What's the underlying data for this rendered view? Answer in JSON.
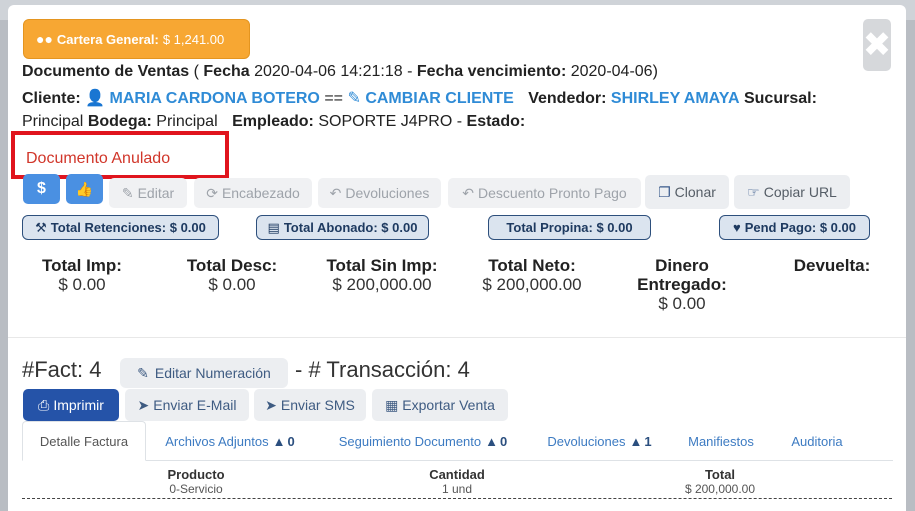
{
  "cartera": {
    "label": "Cartera General:",
    "value": "$ 1,241.00"
  },
  "header": {
    "doc_label": "Documento de Ventas",
    "fecha_label": "Fecha",
    "fecha_value": "2020-04-06 14:21:18",
    "venc_label": "Fecha vencimiento:",
    "venc_value": "2020-04-06",
    "cliente_label": "Cliente:",
    "cliente_name": "MARIA CARDONA BOTERO",
    "cliente_sep": "==",
    "cambiar_cliente": "CAMBIAR CLIENTE",
    "vendedor_label": "Vendedor:",
    "vendedor_name": "SHIRLEY AMAYA",
    "sucursal_label": "Sucursal:",
    "sucursal_value": "Principal",
    "bodega_label": "Bodega:",
    "bodega_value": "Principal",
    "empleado_label": "Empleado:",
    "empleado_value": "SOPORTE J4PRO",
    "estado_label": "Estado:",
    "estado_value": "Documento Anulado"
  },
  "toolbar": {
    "pay_icon": "$",
    "like_icon": "thumbs-up",
    "editar": "Editar",
    "encabezado": "Encabezado",
    "devoluciones": "Devoluciones",
    "descuento": "Descuento Pronto Pago",
    "clonar": "Clonar",
    "copiar_url": "Copiar URL"
  },
  "pills": {
    "retenciones": "Total Retenciones: $ 0.00",
    "abonado": "Total Abonado: $ 0.00",
    "propina": "Total Propina: $ 0.00",
    "pend_pago": "Pend Pago: $ 0.00"
  },
  "totals": [
    {
      "label": "Total Imp:",
      "value": "$ 0.00"
    },
    {
      "label": "Total Desc:",
      "value": "$ 0.00"
    },
    {
      "label": "Total Sin Imp:",
      "value": "$ 200,000.00"
    },
    {
      "label": "Total Neto:",
      "value": "$ 200,000.00"
    },
    {
      "label": "Dinero Entregado:",
      "value": "$ 0.00"
    },
    {
      "label": "Devuelta:",
      "value": ""
    }
  ],
  "factura": {
    "fact_label": "#Fact: 4",
    "editar_numeracion": "Editar Numeración",
    "trans_label": "- # Transacción: 4"
  },
  "actions": {
    "imprimir": "Imprimir",
    "enviar_email": "Enviar E-Mail",
    "enviar_sms": "Enviar SMS",
    "exportar": "Exportar Venta"
  },
  "tabs": [
    {
      "label": "Detalle Factura",
      "count": ""
    },
    {
      "label": "Archivos Adjuntos",
      "count": "0"
    },
    {
      "label": "Seguimiento Documento",
      "count": "0"
    },
    {
      "label": "Devoluciones",
      "count": "1"
    },
    {
      "label": "Manifiestos",
      "count": ""
    },
    {
      "label": "Auditoria",
      "count": ""
    }
  ],
  "table": {
    "headers": [
      "Producto",
      "Cantidad",
      "Total"
    ],
    "rows": [
      [
        "0-Servicio",
        "1 und",
        "$ 200,000.00"
      ]
    ]
  },
  "colors": {
    "accent": "#2f8bd6",
    "warning": "#f7a733",
    "danger": "#e0141d",
    "primary": "#2553a8"
  }
}
